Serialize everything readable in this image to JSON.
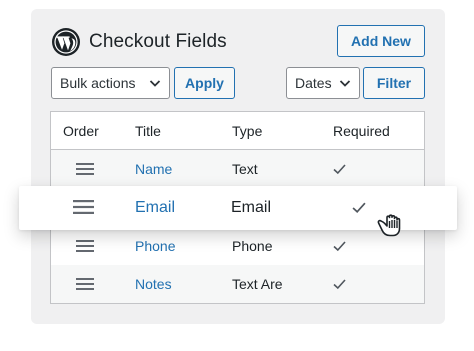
{
  "header": {
    "title": "Checkout Fields",
    "add_new_label": "Add New"
  },
  "toolbar": {
    "bulk_actions_value": "Bulk actions",
    "apply_label": "Apply",
    "dates_value": "Dates",
    "filter_label": "Filter"
  },
  "table": {
    "columns": [
      "Order",
      "Title",
      "Type",
      "Required"
    ],
    "rows": [
      {
        "title": "Name",
        "type": "Text",
        "required": true
      },
      {
        "title": "Email",
        "type": "Email",
        "required": true,
        "dragging": true
      },
      {
        "title": "Phone",
        "type": "Phone",
        "required": true
      },
      {
        "title": "Notes",
        "type": "Text Are",
        "required": true
      }
    ]
  },
  "icons": {
    "logo": "wordpress-logo-icon",
    "row_handle": "drag-handle-icon",
    "required": "checkmark-icon",
    "dropdown": "chevron-down-icon",
    "cursor": "grab-hand-cursor-icon"
  },
  "colors": {
    "accent": "#2271b1",
    "panel_bg": "#f0f0f1",
    "border": "#c3c4c7",
    "text": "#1d2327",
    "alt_row": "#f6f7f7"
  }
}
